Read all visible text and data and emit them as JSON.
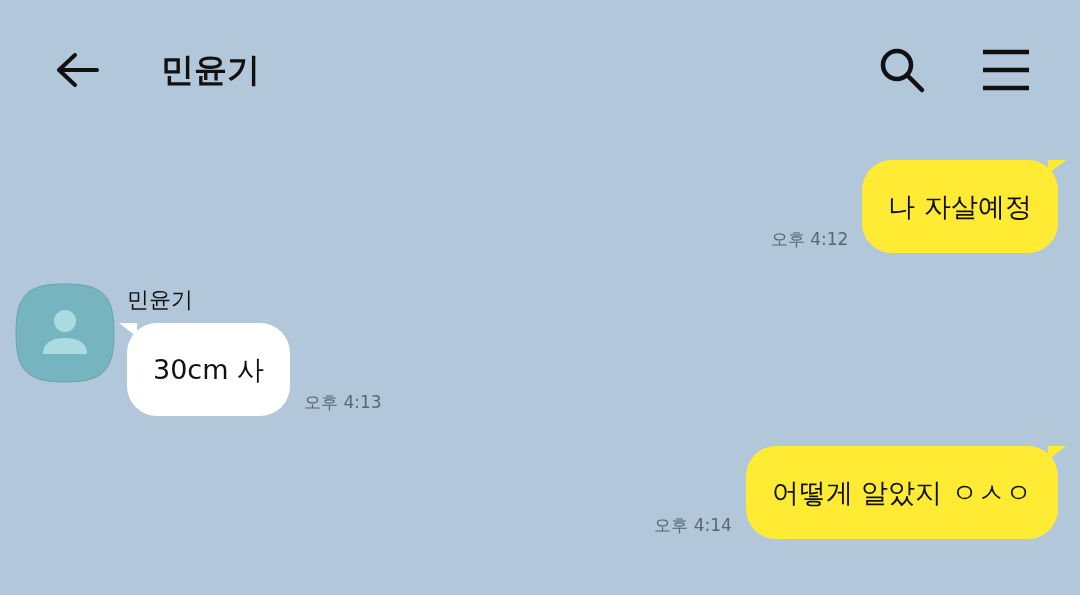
{
  "header": {
    "title": "민윤기"
  },
  "messages": [
    {
      "kind": "sent",
      "text": "나 자살예정",
      "time": "오후 4:12"
    },
    {
      "kind": "received",
      "sender": "민윤기",
      "text": "30cm 사",
      "time": "오후 4:13"
    },
    {
      "kind": "sent",
      "text": "어떻게 알았지 ㅇㅅㅇ",
      "time": "오후 4:14"
    }
  ]
}
